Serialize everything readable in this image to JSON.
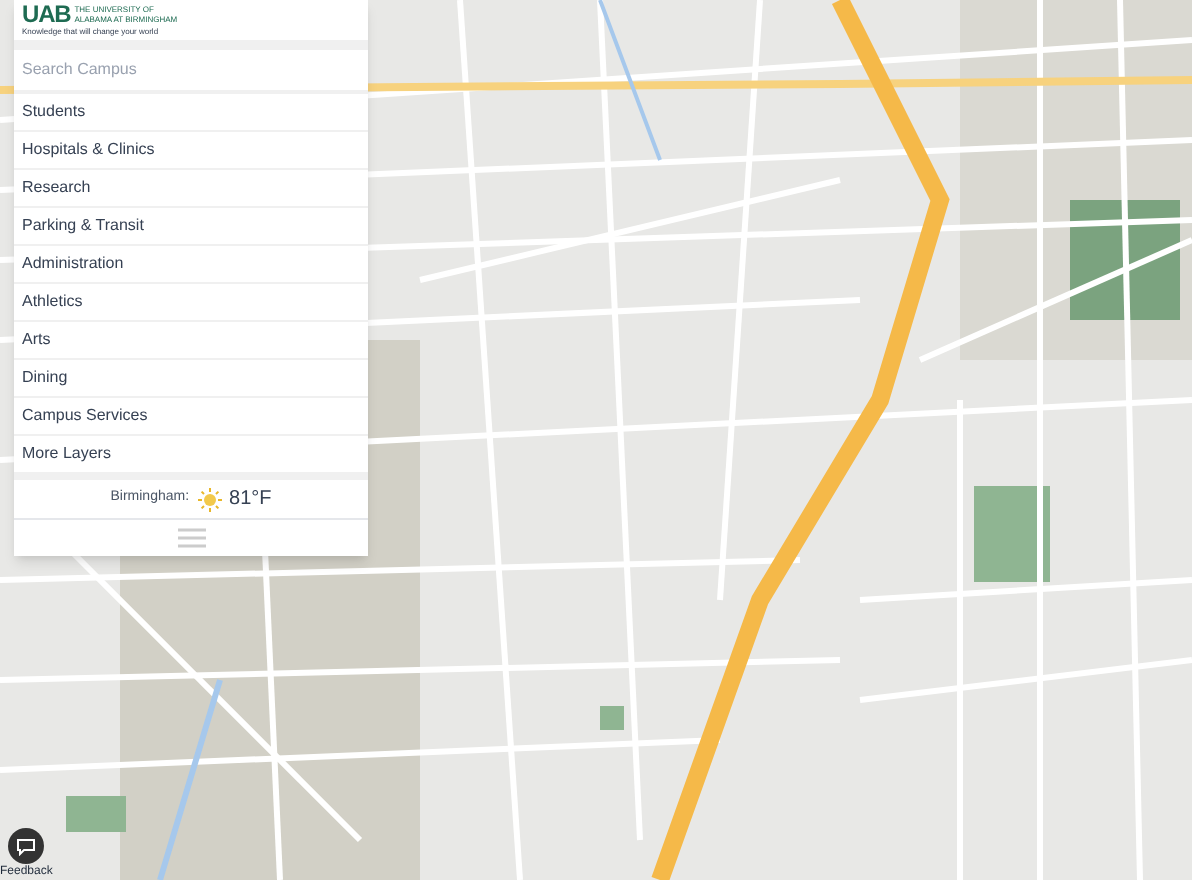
{
  "logo": {
    "mark": "UAB",
    "name": "THE UNIVERSITY OF ALABAMA AT BIRMINGHAM",
    "tagline": "Knowledge that will change your world"
  },
  "search": {
    "placeholder": "Search Campus"
  },
  "menu": [
    {
      "label": "Students"
    },
    {
      "label": "Hospitals & Clinics"
    },
    {
      "label": "Research"
    },
    {
      "label": "Parking & Transit"
    },
    {
      "label": "Administration"
    },
    {
      "label": "Athletics"
    },
    {
      "label": "Arts"
    },
    {
      "label": "Dining"
    },
    {
      "label": "Campus Services"
    },
    {
      "label": "More Layers"
    }
  ],
  "weather": {
    "city": "Birmingham:",
    "temperature": "81°F"
  },
  "feedback": {
    "label": "Feedback"
  }
}
